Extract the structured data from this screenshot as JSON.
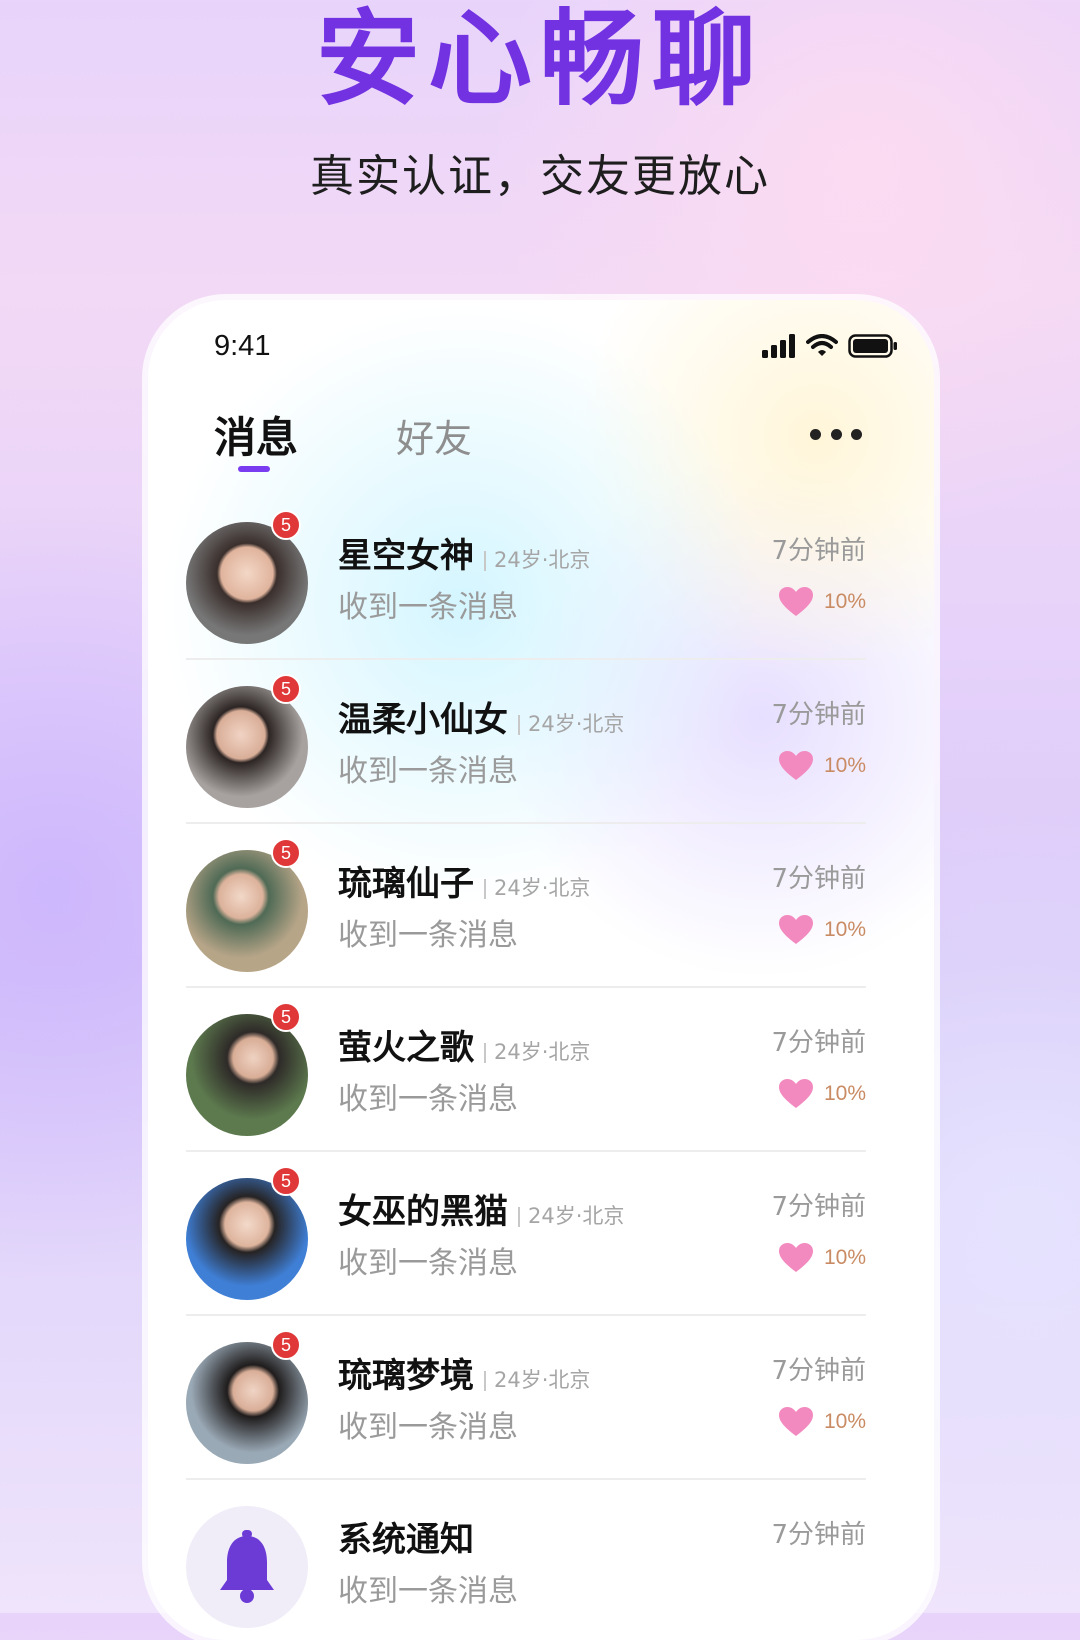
{
  "promo": {
    "title": "安心畅聊",
    "subtitle": "真实认证，交友更放心"
  },
  "status_bar": {
    "time": "9:41",
    "icons": [
      "signal-icon",
      "wifi-icon",
      "battery-icon"
    ]
  },
  "tabs": {
    "messages": "消息",
    "friends": "好友",
    "active": "消息"
  },
  "conversations": [
    {
      "name": "星空女神",
      "meta": "24岁·北京",
      "preview": "收到一条消息",
      "time": "7分钟前",
      "unread": "5",
      "affinity": "10%"
    },
    {
      "name": "温柔小仙女",
      "meta": "24岁·北京",
      "preview": "收到一条消息",
      "time": "7分钟前",
      "unread": "5",
      "affinity": "10%"
    },
    {
      "name": "琉璃仙子",
      "meta": "24岁·北京",
      "preview": "收到一条消息",
      "time": "7分钟前",
      "unread": "5",
      "affinity": "10%"
    },
    {
      "name": "萤火之歌",
      "meta": "24岁·北京",
      "preview": "收到一条消息",
      "time": "7分钟前",
      "unread": "5",
      "affinity": "10%"
    },
    {
      "name": "女巫的黑猫",
      "meta": "24岁·北京",
      "preview": "收到一条消息",
      "time": "7分钟前",
      "unread": "5",
      "affinity": "10%"
    },
    {
      "name": "琉璃梦境",
      "meta": "24岁·北京",
      "preview": "收到一条消息",
      "time": "7分钟前",
      "unread": "5",
      "affinity": "10%"
    }
  ],
  "system_notice": {
    "name": "系统通知",
    "time": "7分钟前",
    "preview": "收到一条消息",
    "icon": "bell-icon"
  },
  "colors": {
    "accent": "#7232e2",
    "badge": "#e03838",
    "affinity_text": "#c98b63",
    "heart": "#f28ac0"
  }
}
